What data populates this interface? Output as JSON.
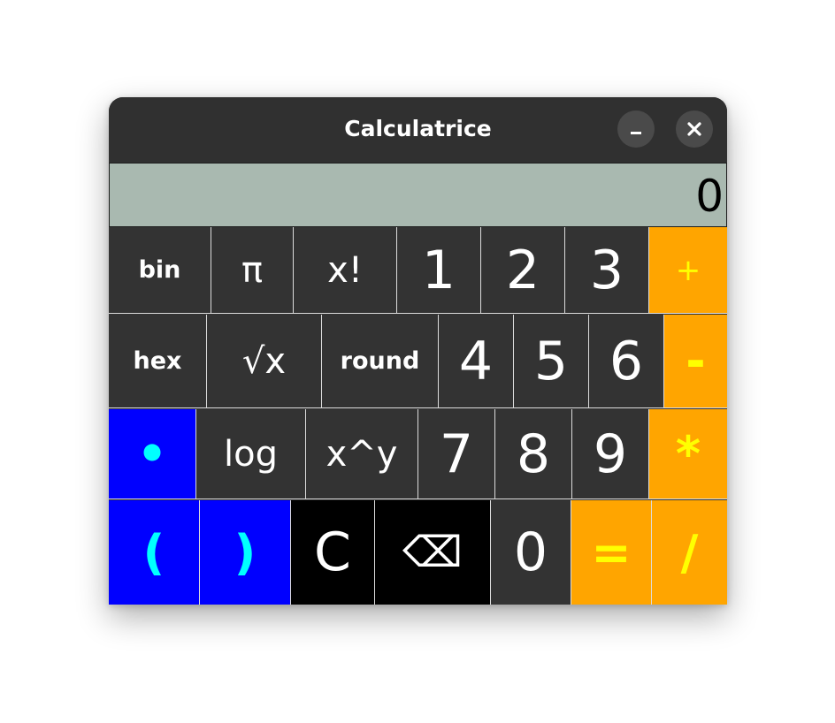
{
  "window": {
    "title": "Calculatrice",
    "minimize_icon": "minimize-icon",
    "close_icon": "close-icon"
  },
  "display": {
    "value": "0"
  },
  "keypad": {
    "row1": [
      "bin",
      "π",
      "x!",
      "1",
      "2",
      "3",
      "+"
    ],
    "row2": [
      "hex",
      "√x",
      "round",
      "4",
      "5",
      "6",
      "-"
    ],
    "row3": [
      "•",
      "log",
      "x^y",
      "7",
      "8",
      "9",
      "*"
    ],
    "row4": [
      "(",
      ")",
      "C",
      "⌫",
      "0",
      "=",
      "/"
    ]
  },
  "colors": {
    "function_key_bg": "#333333",
    "operator_key_bg": "#ffa500",
    "operator_key_text": "#ffff00",
    "paren_key_bg": "#0000ff",
    "paren_key_text": "#00ffff",
    "clear_key_bg": "#000000",
    "display_bg": "#a9b9b0"
  }
}
